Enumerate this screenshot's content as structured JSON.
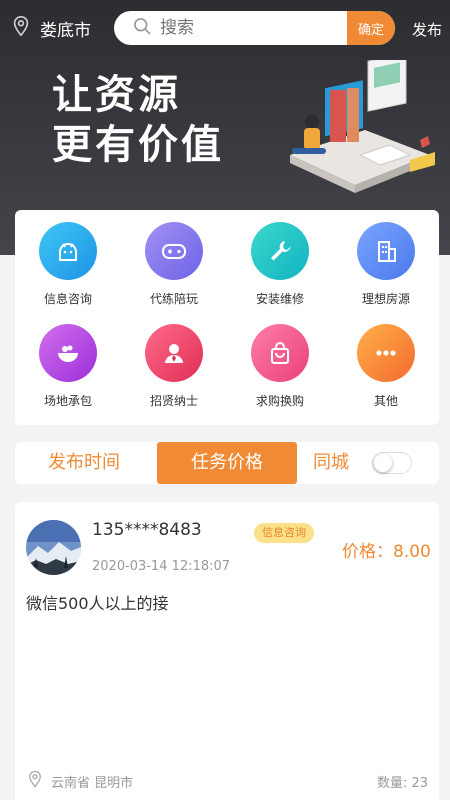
{
  "header": {
    "city": "娄底市",
    "search_placeholder": "搜索",
    "search_button": "确定",
    "publish": "发布"
  },
  "banner": {
    "line1": "让资源",
    "line2": "更有价值"
  },
  "categories": [
    {
      "label": "信息咨询",
      "icon": "android-icon",
      "color": "#2ab3ee"
    },
    {
      "label": "代练陪玩",
      "icon": "gamepad-icon",
      "color": "#8b7cf0"
    },
    {
      "label": "安装维修",
      "icon": "wrench-icon",
      "color": "#1ec8c8"
    },
    {
      "label": "理想房源",
      "icon": "building-icon",
      "color": "#5b8ef5"
    },
    {
      "label": "场地承包",
      "icon": "bowl-icon",
      "color": "#c04be0"
    },
    {
      "label": "招贤纳士",
      "icon": "person-icon",
      "color": "#f0476e"
    },
    {
      "label": "求购换购",
      "icon": "shopping-bag-icon",
      "color": "#f05a8a"
    },
    {
      "label": "其他",
      "icon": "more-icon",
      "color": "#f7923a"
    }
  ],
  "tabs": {
    "time": "发布时间",
    "price": "任务价格",
    "city": "同城",
    "same_city_on": false
  },
  "task": {
    "phone": "135****8483",
    "badge": "信息咨询",
    "price": "价格：8.00",
    "time": "2020-03-14 12:18:07",
    "description": "微信500人以上的接",
    "location": "云南省 昆明市",
    "count": "数量: 23"
  },
  "colors": {
    "accent": "#f08a35",
    "banner_bg": "#2c2d31"
  }
}
